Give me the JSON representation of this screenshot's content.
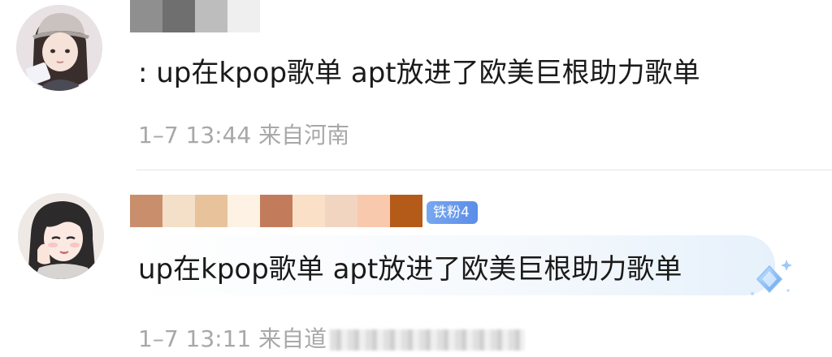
{
  "comments": [
    {
      "username_mosaic_colors": [
        "#8f8f8f",
        "#ffffff",
        "#6f6f6f",
        "#bdbdbd",
        "#efefef"
      ],
      "text": ": up在kpop歌单 apt放进了欧美巨根助力歌单",
      "time": "1–7 13:44",
      "location": "来自河南"
    },
    {
      "username_mosaic_colors": [
        "#c98f6d",
        "#f4dfc8",
        "#e8c29b",
        "#fdf2e4",
        "#c27c5b",
        "#f9e0c6",
        "#f2d5c0",
        "#f9c9ad",
        "#b45b19"
      ],
      "badge": "铁粉4",
      "text": "up在kpop歌单 apt放进了欧美巨根助力歌单",
      "time": "1–7 13:11",
      "location": "来自道"
    }
  ],
  "colors": {
    "text": "#1a1a1a",
    "meta": "#a8a8a8",
    "badge": "#6b9bec",
    "divider": "#e6e6e6"
  },
  "icons": {
    "second_comment_decoration": "diamond-sparkle-icon"
  }
}
